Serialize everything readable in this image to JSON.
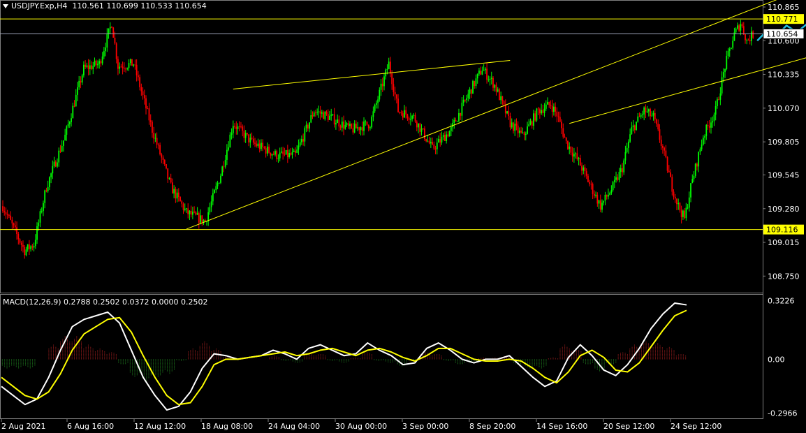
{
  "header": {
    "symbol": "USDJPY.Exp,H4",
    "ohlc": "110.561 110.699 110.533 110.654"
  },
  "macd_header": {
    "title": "MACD(12,26,9)",
    "values": "0.2788 0.2502 0.0372 0.0000 0.2502"
  },
  "colors": {
    "background": "#000000",
    "bull_candle": "#00ff00",
    "bear_candle": "#ff0000",
    "trendline": "#ffff00",
    "macd_line": "#ffffff",
    "signal_line": "#ffff00",
    "hist_pos": "#b22222",
    "hist_neg": "#228b22",
    "arrow": "#1fbfe0",
    "grid": "#808080"
  },
  "chart_data": [
    {
      "type": "candlestick",
      "title": "USDJPY.Exp,H4",
      "y_ticks": [
        "110.865",
        "110.600",
        "110.335",
        "110.070",
        "109.805",
        "109.545",
        "109.280",
        "109.015",
        "108.750"
      ],
      "ylim": [
        108.62,
        110.92
      ],
      "x_ticks": [
        "2 Aug 2021",
        "6 Aug 16:00",
        "12 Aug 12:00",
        "18 Aug 08:00",
        "24 Aug 04:00",
        "30 Aug 00:00",
        "3 Sep 00:00",
        "8 Sep 20:00",
        "14 Sep 16:00",
        "20 Sep 12:00",
        "24 Sep 12:00"
      ],
      "price_labels": [
        {
          "text": "110.771",
          "value": 110.771,
          "style": "yellow"
        },
        {
          "text": "110.654",
          "value": 110.654,
          "style": "white"
        },
        {
          "text": "109.116",
          "value": 109.116,
          "style": "yellow"
        }
      ],
      "horizontal_lines": [
        110.771,
        110.654,
        109.116
      ],
      "waypoints": [
        [
          0,
          109.3
        ],
        [
          8,
          109.1
        ],
        [
          14,
          108.95
        ],
        [
          20,
          109.0
        ],
        [
          28,
          109.45
        ],
        [
          40,
          109.85
        ],
        [
          52,
          110.38
        ],
        [
          62,
          110.42
        ],
        [
          70,
          110.74
        ],
        [
          74,
          110.4
        ],
        [
          84,
          110.42
        ],
        [
          96,
          109.9
        ],
        [
          108,
          109.45
        ],
        [
          118,
          109.25
        ],
        [
          130,
          109.18
        ],
        [
          140,
          109.55
        ],
        [
          148,
          109.95
        ],
        [
          160,
          109.8
        ],
        [
          176,
          109.7
        ],
        [
          188,
          109.7
        ],
        [
          200,
          110.05
        ],
        [
          210,
          110.0
        ],
        [
          224,
          109.9
        ],
        [
          236,
          109.95
        ],
        [
          248,
          110.42
        ],
        [
          254,
          110.05
        ],
        [
          264,
          110.0
        ],
        [
          276,
          109.75
        ],
        [
          288,
          109.9
        ],
        [
          300,
          110.2
        ],
        [
          308,
          110.38
        ],
        [
          316,
          110.25
        ],
        [
          326,
          109.95
        ],
        [
          334,
          109.85
        ],
        [
          344,
          110.05
        ],
        [
          352,
          110.1
        ],
        [
          356,
          110.02
        ],
        [
          362,
          109.8
        ],
        [
          370,
          109.65
        ],
        [
          378,
          109.45
        ],
        [
          384,
          109.3
        ],
        [
          392,
          109.45
        ],
        [
          398,
          109.6
        ],
        [
          404,
          109.9
        ],
        [
          412,
          110.05
        ],
        [
          418,
          110.0
        ],
        [
          424,
          109.75
        ],
        [
          430,
          109.45
        ],
        [
          434,
          109.3
        ],
        [
          438,
          109.2
        ],
        [
          442,
          109.45
        ],
        [
          450,
          109.85
        ],
        [
          458,
          110.05
        ],
        [
          464,
          110.4
        ],
        [
          470,
          110.65
        ],
        [
          474,
          110.74
        ],
        [
          478,
          110.6
        ],
        [
          482,
          110.65
        ]
      ],
      "trendlines": [
        {
          "x": [
            118,
            482
          ],
          "y": [
            109.12,
            110.85
          ]
        },
        {
          "x": [
            148,
            290
          ],
          "y": [
            110.22,
            110.4
          ]
        },
        {
          "x": [
            364,
            482
          ],
          "y": [
            109.95,
            110.35
          ]
        }
      ],
      "projection_arrows": [
        [
          0,
          0
        ],
        [
          8,
          25
        ],
        [
          14,
          10
        ],
        [
          22,
          35
        ],
        [
          30,
          20
        ],
        [
          38,
          40
        ],
        [
          46,
          90
        ]
      ]
    },
    {
      "type": "line",
      "title": "MACD(12,26,9)",
      "y_ticks": [
        "0.3226",
        "0.00",
        "-0.2966"
      ],
      "ylim": [
        -0.33,
        0.36
      ],
      "series": [
        {
          "values": [
            -0.15,
            -0.2,
            -0.25,
            -0.22,
            -0.1,
            0.05,
            0.18,
            0.22,
            0.24,
            0.26,
            0.2,
            0.05,
            -0.1,
            -0.2,
            -0.28,
            -0.26,
            -0.18,
            -0.05,
            0.03,
            0.02,
            0.0,
            0.01,
            0.02,
            0.05,
            0.03,
            0.0,
            0.06,
            0.08,
            0.05,
            0.02,
            0.03,
            0.09,
            0.05,
            0.02,
            -0.03,
            -0.02,
            0.06,
            0.09,
            0.05,
            0.0,
            -0.02,
            0.0,
            0.0,
            0.02,
            -0.04,
            -0.1,
            -0.15,
            -0.12,
            0.01,
            0.08,
            0.02,
            -0.06,
            -0.09,
            -0.03,
            0.06,
            0.17,
            0.25,
            0.31,
            0.3
          ]
        },
        {
          "values": [
            -0.1,
            -0.15,
            -0.2,
            -0.22,
            -0.18,
            -0.08,
            0.05,
            0.14,
            0.18,
            0.22,
            0.23,
            0.15,
            0.02,
            -0.1,
            -0.2,
            -0.25,
            -0.24,
            -0.15,
            -0.03,
            0.0,
            0.0,
            0.01,
            0.02,
            0.03,
            0.04,
            0.02,
            0.03,
            0.05,
            0.06,
            0.04,
            0.02,
            0.05,
            0.06,
            0.04,
            0.01,
            -0.01,
            0.02,
            0.06,
            0.06,
            0.03,
            0.0,
            -0.01,
            -0.01,
            0.0,
            -0.01,
            -0.05,
            -0.1,
            -0.13,
            -0.07,
            0.02,
            0.05,
            0.01,
            -0.06,
            -0.07,
            -0.02,
            0.07,
            0.16,
            0.24,
            0.27
          ]
        }
      ],
      "histogram": [
        -0.05,
        -0.05,
        -0.05,
        0.0,
        0.08,
        0.13,
        0.13,
        0.08,
        0.06,
        0.04,
        -0.03,
        -0.1,
        -0.12,
        -0.1,
        -0.08,
        -0.01,
        0.06,
        0.1,
        0.06,
        0.02,
        0.0,
        0.0,
        0.0,
        0.02,
        -0.01,
        -0.02,
        0.03,
        0.03,
        -0.01,
        -0.02,
        0.01,
        0.04,
        -0.01,
        -0.02,
        -0.04,
        -0.01,
        0.04,
        0.03,
        -0.01,
        -0.03,
        -0.02,
        0.01,
        0.01,
        0.02,
        -0.03,
        -0.05,
        -0.05,
        0.01,
        0.08,
        0.06,
        -0.03,
        -0.07,
        -0.03,
        0.04,
        0.08,
        0.1,
        0.09,
        0.07,
        0.03
      ]
    }
  ]
}
